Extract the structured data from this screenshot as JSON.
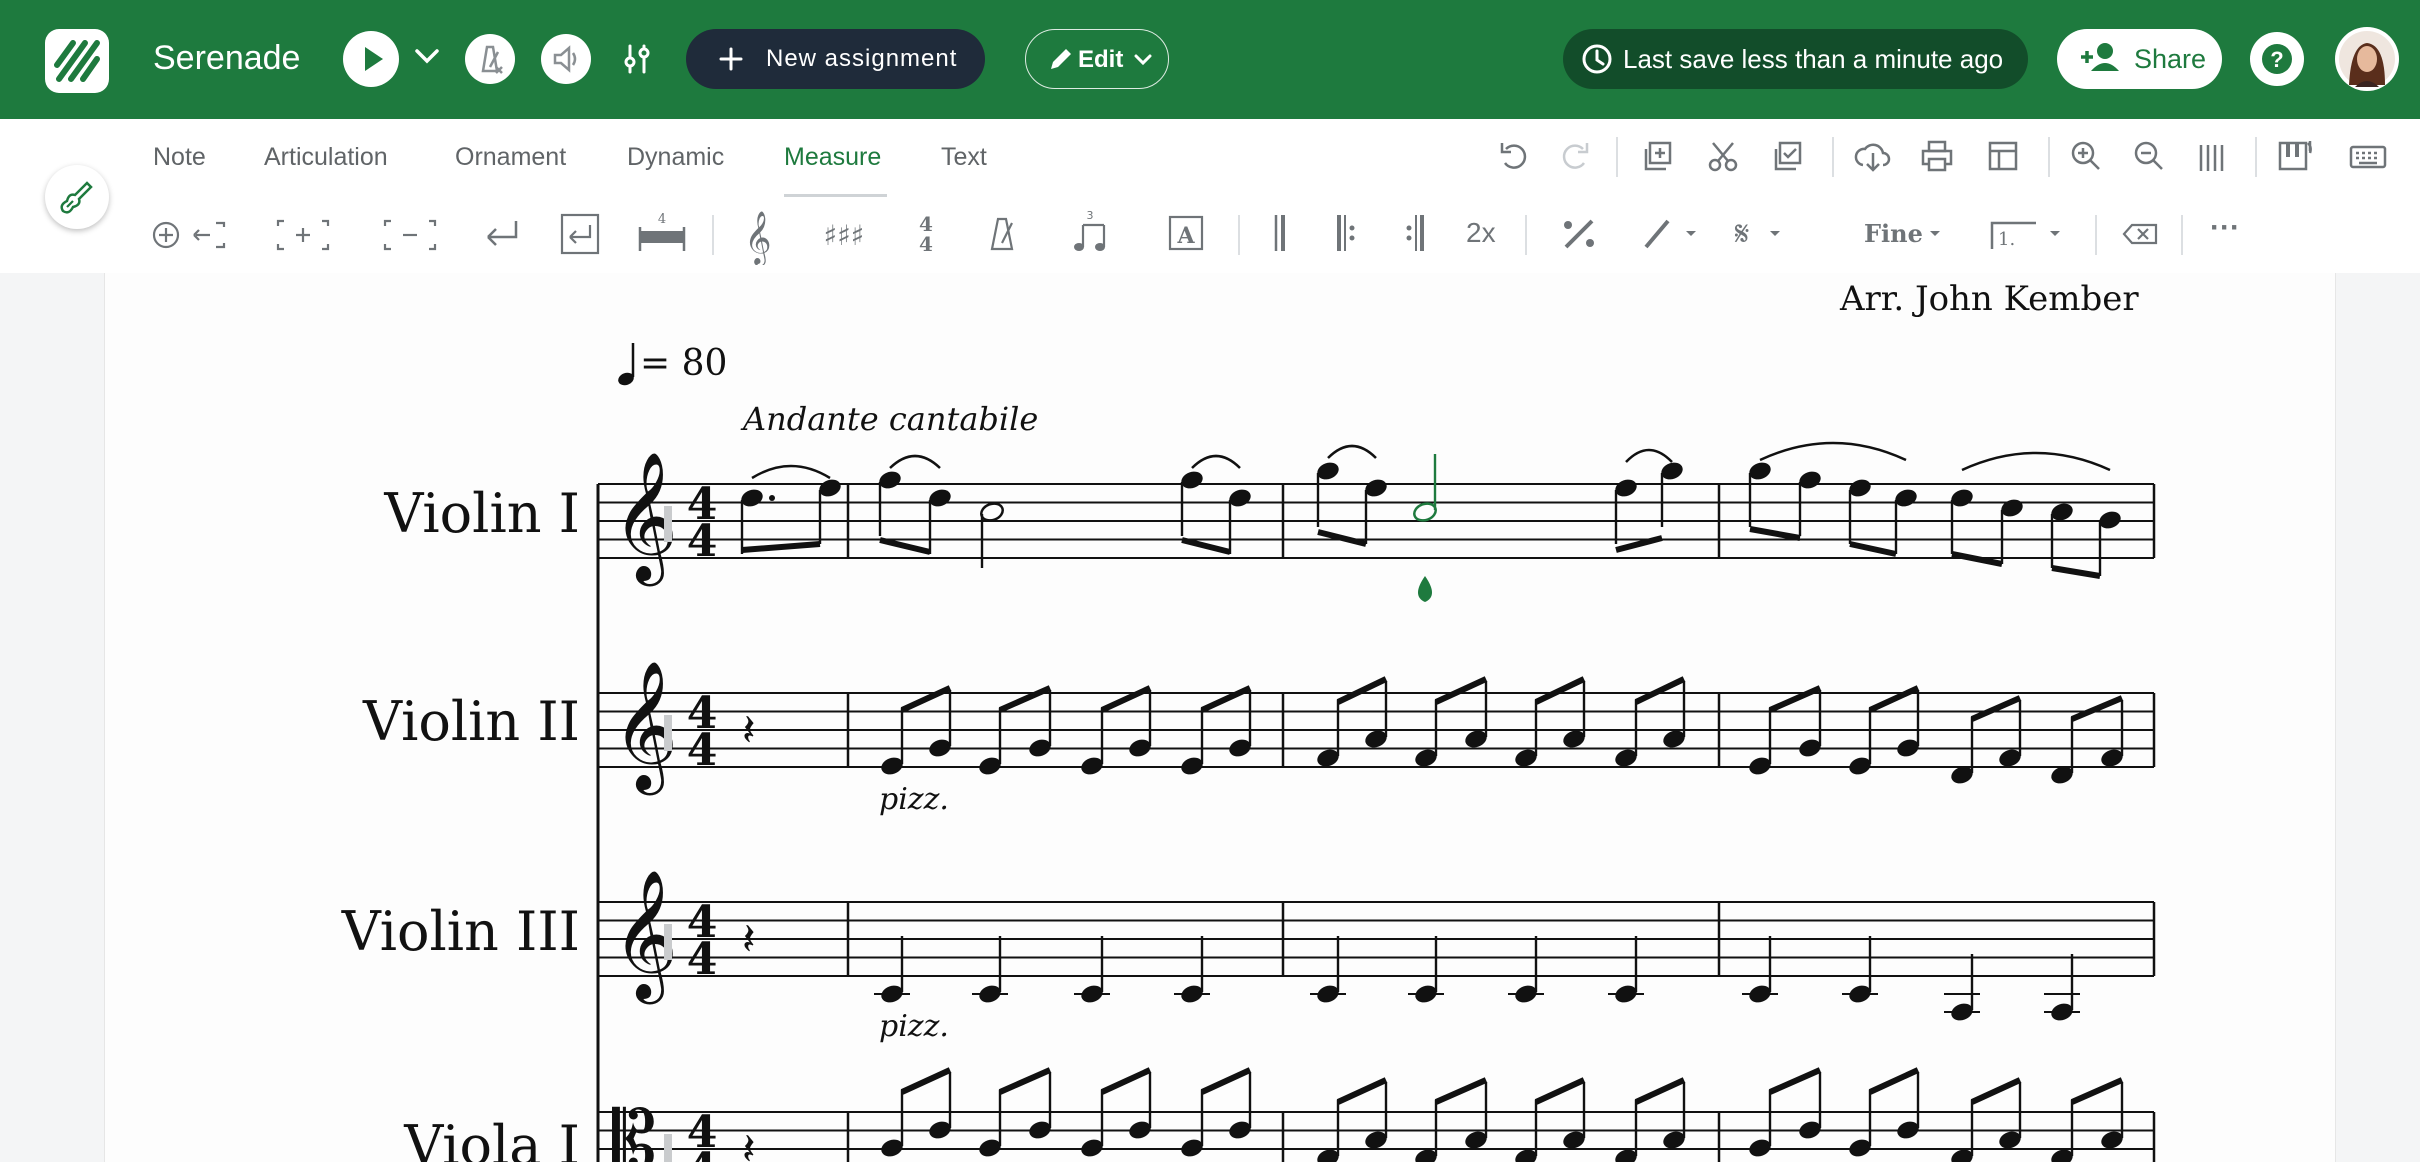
{
  "app": {
    "title": "Serenade",
    "new_assignment_label": "New assignment",
    "edit_label": "Edit",
    "save_status": "Last save less than a minute ago",
    "share_label": "Share",
    "brand_color": "#1e7a3e"
  },
  "menu_tabs": [
    {
      "label": "Note",
      "active": false
    },
    {
      "label": "Articulation",
      "active": false
    },
    {
      "label": "Ornament",
      "active": false
    },
    {
      "label": "Dynamic",
      "active": false
    },
    {
      "label": "Measure",
      "active": true
    },
    {
      "label": "Text",
      "active": false
    }
  ],
  "right_tools": [
    "undo-icon",
    "redo-icon",
    "duplicate-icon",
    "cut-icon",
    "paste-icon",
    "download-icon",
    "print-icon",
    "layout-icon",
    "zoom-in-icon",
    "zoom-out-icon",
    "barlines-view-icon",
    "piano-icon",
    "keyboard-icon"
  ],
  "toolbar": {
    "time_sig_top": "4",
    "repeat_label": "2x",
    "fine_label": "Fine",
    "ending_label": "1.",
    "more_label": "···"
  },
  "score": {
    "arranger": "Arr. John Kember",
    "tempo_value": "= 80",
    "expression": "Andante cantabile",
    "time_signature": "4/4",
    "instruments": [
      {
        "name": "Violin I",
        "clef": "treble"
      },
      {
        "name": "Violin II",
        "clef": "treble",
        "technique": "pizz."
      },
      {
        "name": "Violin III",
        "clef": "treble",
        "technique": "pizz."
      },
      {
        "name": "Viola I",
        "clef": "alto"
      }
    ]
  }
}
